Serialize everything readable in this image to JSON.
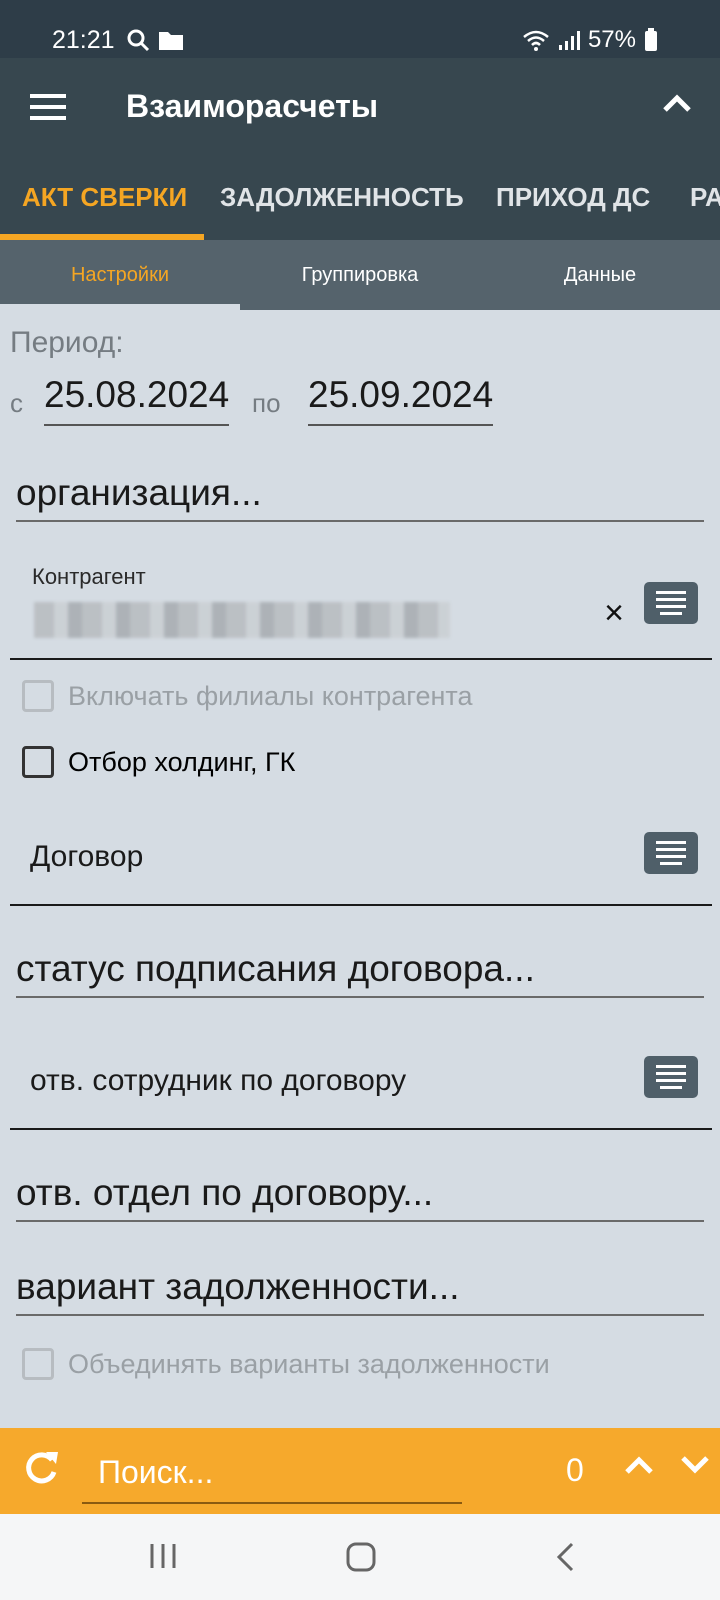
{
  "status_bar": {
    "time": "21:21",
    "battery": "57%"
  },
  "app_bar": {
    "title": "Взаиморасчеты"
  },
  "main_tabs": [
    {
      "label": "АКТ СВЕРКИ",
      "active": true
    },
    {
      "label": "ЗАДОЛЖЕННОСТЬ",
      "active": false
    },
    {
      "label": "ПРИХОД ДС",
      "active": false
    },
    {
      "label": "РА",
      "active": false
    }
  ],
  "sub_tabs": [
    {
      "label": "Настройки",
      "active": true
    },
    {
      "label": "Группировка",
      "active": false
    },
    {
      "label": "Данные",
      "active": false
    }
  ],
  "period": {
    "label": "Период:",
    "from_label": "с",
    "from": "25.08.2024",
    "to_label": "по",
    "to": "25.09.2024"
  },
  "organization": {
    "placeholder": "организация..."
  },
  "contractor": {
    "caption": "Контрагент",
    "clear": "×"
  },
  "checkboxes": {
    "include_branches": {
      "label": "Включать филиалы контрагента",
      "checked": false,
      "disabled": true
    },
    "holding_filter": {
      "label": "Отбор холдинг, ГК",
      "checked": false,
      "disabled": false
    },
    "merge_variants": {
      "label": "Объединять варианты задолженности",
      "checked": false,
      "disabled": true
    }
  },
  "contract": {
    "label": "Договор"
  },
  "contract_status": {
    "placeholder": "статус подписания договора..."
  },
  "responsible_employee": {
    "label": "отв. сотрудник по договору"
  },
  "responsible_department": {
    "placeholder": "отв. отдел по договору..."
  },
  "debt_variant": {
    "placeholder": "вариант задолженности..."
  },
  "search": {
    "placeholder": "Поиск...",
    "count": "0"
  },
  "colors": {
    "accent": "#f5a623",
    "app_bar": "#37474f",
    "background": "#d5dce3"
  }
}
